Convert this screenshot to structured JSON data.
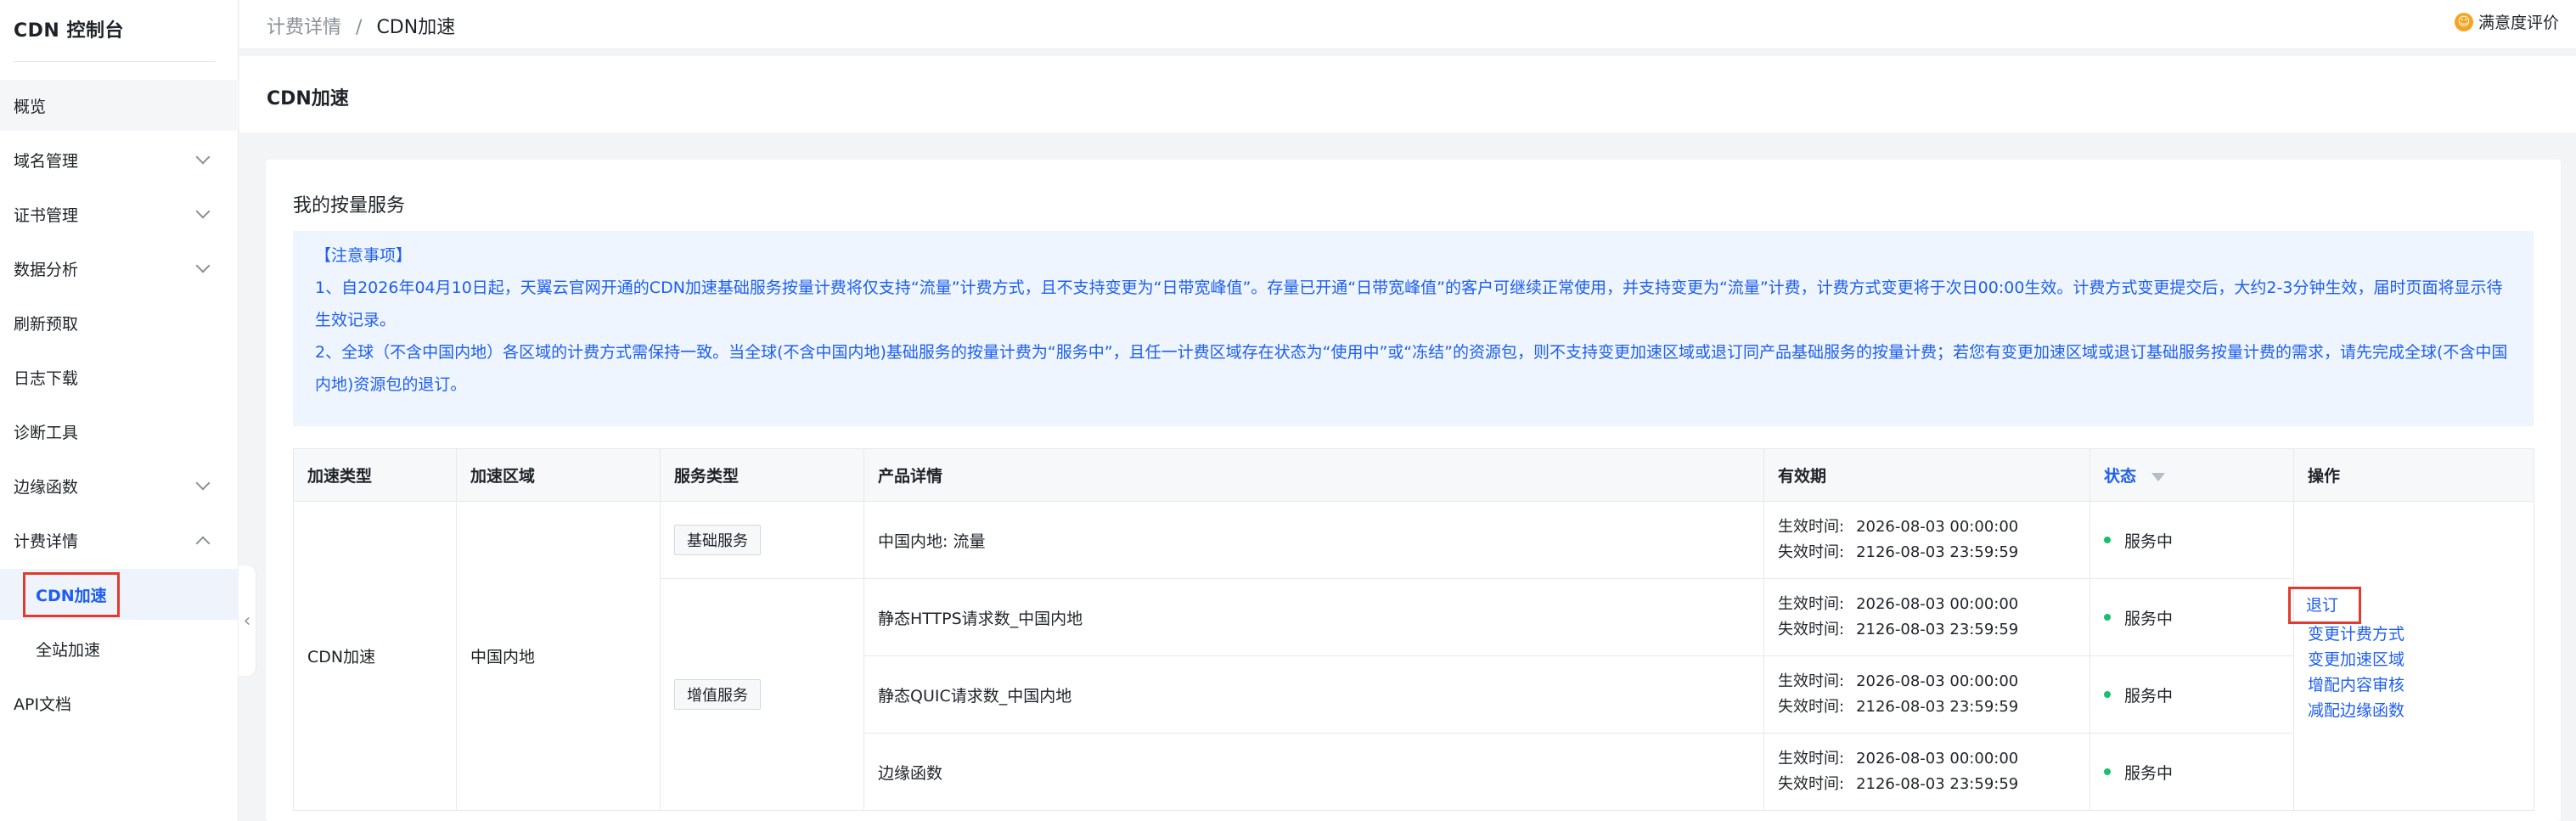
{
  "sidebar": {
    "title": "CDN 控制台",
    "items": [
      {
        "label": "概览"
      },
      {
        "label": "域名管理"
      },
      {
        "label": "证书管理"
      },
      {
        "label": "数据分析"
      },
      {
        "label": "刷新预取"
      },
      {
        "label": "日志下载"
      },
      {
        "label": "诊断工具"
      },
      {
        "label": "边缘函数"
      },
      {
        "label": "计费详情"
      },
      {
        "label": "CDN加速"
      },
      {
        "label": "全站加速"
      },
      {
        "label": "API文档"
      }
    ],
    "collapse_glyph": "‹"
  },
  "header": {
    "breadcrumb": [
      "计费详情",
      "CDN加速"
    ],
    "breadcrumb_sep": "/",
    "satisfaction": "满意度评价",
    "page_title": "CDN加速"
  },
  "card": {
    "title": "我的按量服务",
    "notice": {
      "heading": "【注意事项】",
      "line1": "1、自2026年04月10日起，天翼云官网开通的CDN加速基础服务按量计费将仅支持“流量”计费方式，且不支持变更为“日带宽峰值”。存量已开通“日带宽峰值”的客户可继续正常使用，并支持变更为“流量”计费，计费方式变更将于次日00:00生效。计费方式变更提交后，大约2-3分钟生效，届时页面将显示待生效记录。",
      "line2": "2、全球（不含中国内地）各区域的计费方式需保持一致。当全球(不含中国内地)基础服务的按量计费为“服务中”，且任一计费区域存在状态为“使用中”或“冻结”的资源包，则不支持变更加速区域或退订同产品基础服务的按量计费；若您有变更加速区域或退订基础服务按量计费的需求，请先完成全球(不含中国内地)资源包的退订。"
    },
    "table": {
      "headers": [
        "加速类型",
        "加速区域",
        "服务类型",
        "产品详情",
        "有效期",
        "状态",
        "操作"
      ],
      "accel_type": "CDN加速",
      "region": "中国内地",
      "service_basic": "基础服务",
      "service_value": "增值服务",
      "effective_label": "生效时间:",
      "expire_label": "失效时间:",
      "rows": [
        {
          "detail": "中国内地: 流量",
          "start": "2026-08-03 00:00:00",
          "end": "2126-08-03 23:59:59",
          "status": "服务中"
        },
        {
          "detail": "静态HTTPS请求数_中国内地",
          "start": "2026-08-03 00:00:00",
          "end": "2126-08-03 23:59:59",
          "status": "服务中"
        },
        {
          "detail": "静态QUIC请求数_中国内地",
          "start": "2026-08-03 00:00:00",
          "end": "2126-08-03 23:59:59",
          "status": "服务中"
        },
        {
          "detail": "边缘函数",
          "start": "2026-08-03 00:00:00",
          "end": "2126-08-03 23:59:59",
          "status": "服务中"
        }
      ],
      "ops": [
        "退订",
        "变更计费方式",
        "变更加速区域",
        "增配内容审核",
        "减配边缘函数"
      ]
    }
  },
  "colors": {
    "accent": "#1e5ef0",
    "status_ok": "#15c26b",
    "highlight": "#e23b2e"
  }
}
